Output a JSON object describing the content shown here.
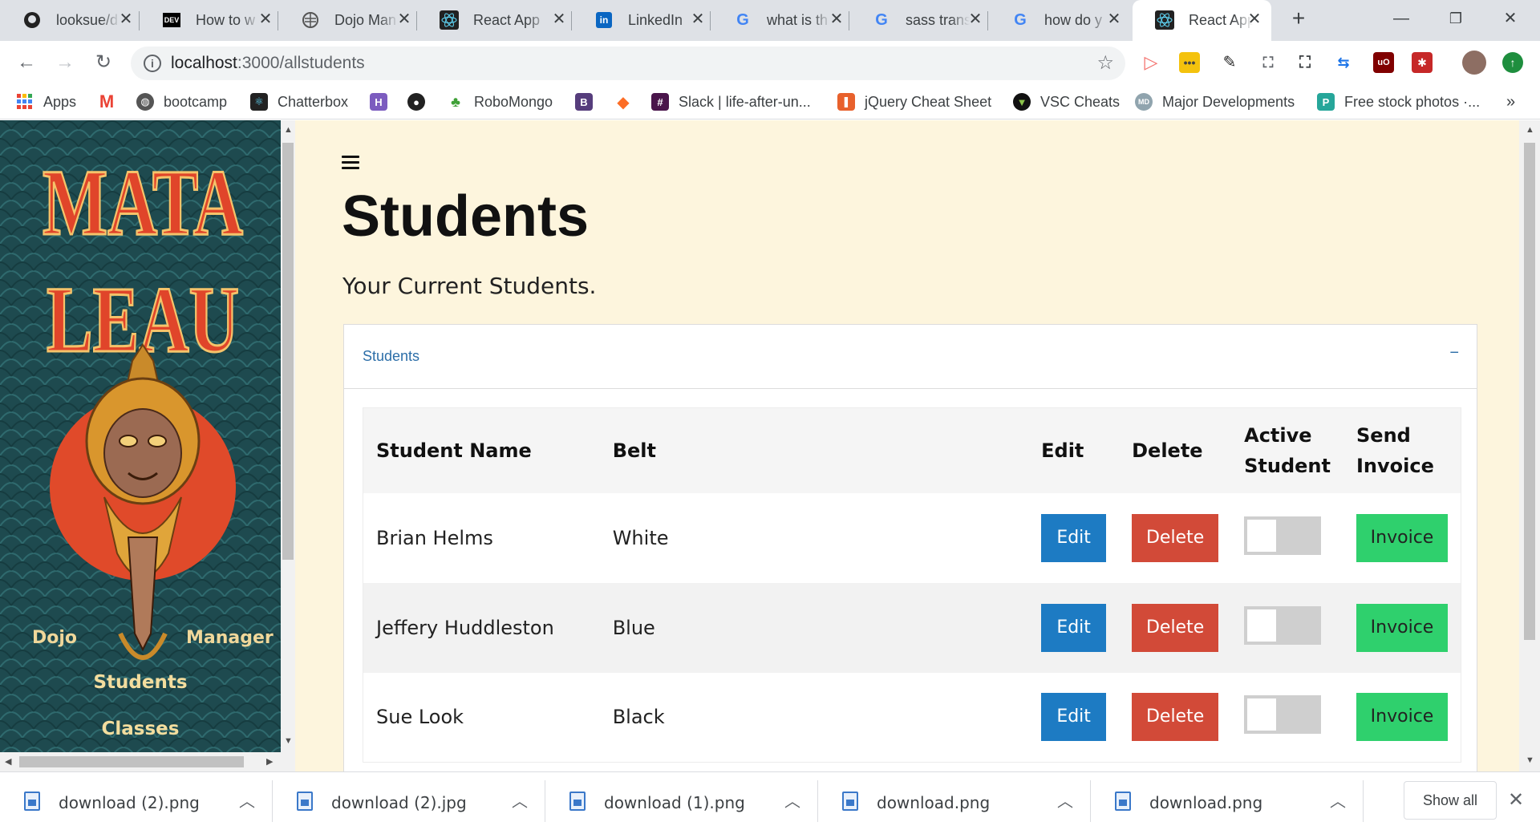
{
  "tabs": [
    {
      "title": "looksue/d",
      "icon": "github-icon"
    },
    {
      "title": "How to w",
      "icon": "dev-icon"
    },
    {
      "title": "Dojo Man",
      "icon": "globe-icon"
    },
    {
      "title": "React App",
      "icon": "react-icon"
    },
    {
      "title": "LinkedIn",
      "icon": "linkedin-icon"
    },
    {
      "title": "what is th",
      "icon": "google-icon"
    },
    {
      "title": "sass trans",
      "icon": "google-icon"
    },
    {
      "title": "how do y",
      "icon": "google-icon"
    },
    {
      "title": "React App",
      "icon": "react-icon",
      "active": true
    }
  ],
  "address": {
    "host": "localhost",
    "path": ":3000/allstudents"
  },
  "bookmarks": [
    {
      "label": "Apps",
      "icon": "apps-grid-icon"
    },
    {
      "label": "",
      "icon": "gmail-icon"
    },
    {
      "label": "bootcamp",
      "icon": "globe-icon"
    },
    {
      "label": "Chatterbox",
      "icon": "react-icon"
    },
    {
      "label": "",
      "icon": "h-icon"
    },
    {
      "label": "",
      "icon": "github-icon"
    },
    {
      "label": "RoboMongo",
      "icon": "robomongo-icon"
    },
    {
      "label": "",
      "icon": "bootstrap-icon"
    },
    {
      "label": "",
      "icon": "gitlab-icon"
    },
    {
      "label": "Slack | life-after-un...",
      "icon": "slack-icon"
    },
    {
      "label": "jQuery Cheat Sheet",
      "icon": "jquery-icon"
    },
    {
      "label": "VSC Cheats",
      "icon": "vsc-icon"
    },
    {
      "label": "Major Developments",
      "icon": "md-icon"
    },
    {
      "label": "Free stock photos ·...",
      "icon": "pexels-icon"
    }
  ],
  "sidebar": {
    "logo_line1": "MATA",
    "logo_line2": "LEAU",
    "brand_left": "Dojo",
    "brand_right": "Manager",
    "nav": [
      "Students",
      "Classes"
    ]
  },
  "page": {
    "title": "Students",
    "subtitle": "Your Current Students.",
    "panel_title": "Students",
    "panel_toggle": "−"
  },
  "table": {
    "headers": {
      "name": "Student Name",
      "belt": "Belt",
      "edit": "Edit",
      "delete": "Delete",
      "active": "Active Student",
      "invoice": "Send Invoice"
    },
    "rows": [
      {
        "name": "Brian Helms",
        "belt": "White",
        "edit": "Edit",
        "delete": "Delete",
        "invoice": "Invoice",
        "active": false
      },
      {
        "name": "Jeffery Huddleston",
        "belt": "Blue",
        "edit": "Edit",
        "delete": "Delete",
        "invoice": "Invoice",
        "active": false
      },
      {
        "name": "Sue Look",
        "belt": "Black",
        "edit": "Edit",
        "delete": "Delete",
        "invoice": "Invoice",
        "active": false
      }
    ]
  },
  "downloads": [
    {
      "name": "download (2).png"
    },
    {
      "name": "download (2).jpg"
    },
    {
      "name": "download (1).png"
    },
    {
      "name": "download.png"
    },
    {
      "name": "download.png"
    }
  ],
  "download_bar": {
    "show_all": "Show all"
  },
  "colors": {
    "edit": "#1d7bc3",
    "delete": "#d24a38",
    "invoice": "#2fd06d",
    "page_bg": "#fdf5dd",
    "sidebar_bg": "#1f4a4e",
    "logo_red": "#e04a2a"
  }
}
